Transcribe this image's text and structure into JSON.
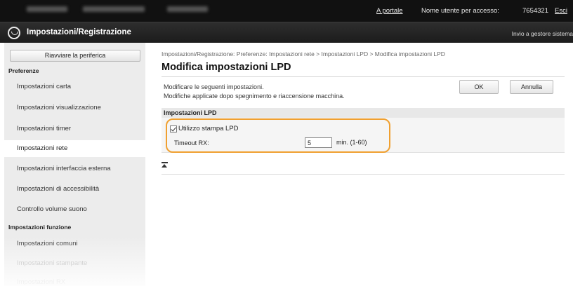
{
  "topbar": {
    "portal_link": "A portale",
    "user_label": "Nome utente per accesso:",
    "user_id": "7654321",
    "logout_link": "Esci"
  },
  "header": {
    "title": "Impostazioni/Registrazione",
    "admin_link": "Invio a gestore sistema"
  },
  "sidebar": {
    "restart_button": "Riavviare la periferica",
    "preferences_heading": "Preferenze",
    "items": [
      {
        "label": "Impostazioni carta"
      },
      {
        "label": "Impostazioni visualizzazione"
      },
      {
        "label": "Impostazioni timer"
      },
      {
        "label": "Impostazioni rete"
      },
      {
        "label": "Impostazioni interfaccia esterna"
      },
      {
        "label": "Impostazioni di accessibilità"
      },
      {
        "label": "Controllo volume suono"
      }
    ],
    "function_heading": "Impostazioni funzione",
    "function_items": [
      {
        "label": "Impostazioni comuni"
      },
      {
        "label": "Impostazioni stampante"
      },
      {
        "label": "Impostazioni RX"
      }
    ]
  },
  "main": {
    "breadcrumb": "Impostazioni/Registrazione: Preferenze: Impostazioni rete > Impostazioni LPD > Modifica impostazioni LPD",
    "title": "Modifica impostazioni LPD",
    "description_1": "Modificare le seguenti impostazioni.",
    "description_2": "Modifiche applicate dopo spegnimento e riaccensione macchina.",
    "ok_button": "OK",
    "cancel_button": "Annulla",
    "section_title": "Impostazioni LPD",
    "lpd_checkbox_label": "Utilizzo stampa LPD",
    "lpd_checked": true,
    "timeout_label": "Timeout RX:",
    "timeout_value": "5",
    "timeout_unit": "min. (1-60)"
  },
  "colors": {
    "topbar": "#111111",
    "titlebar": "#242424",
    "sidebar": "#ececec",
    "highlight": "#f0a030"
  },
  "icons": {
    "app_logo": "settings-logo-icon",
    "back_to_top": "back-to-top-icon",
    "checkbox": "checkbox-checked-icon"
  }
}
